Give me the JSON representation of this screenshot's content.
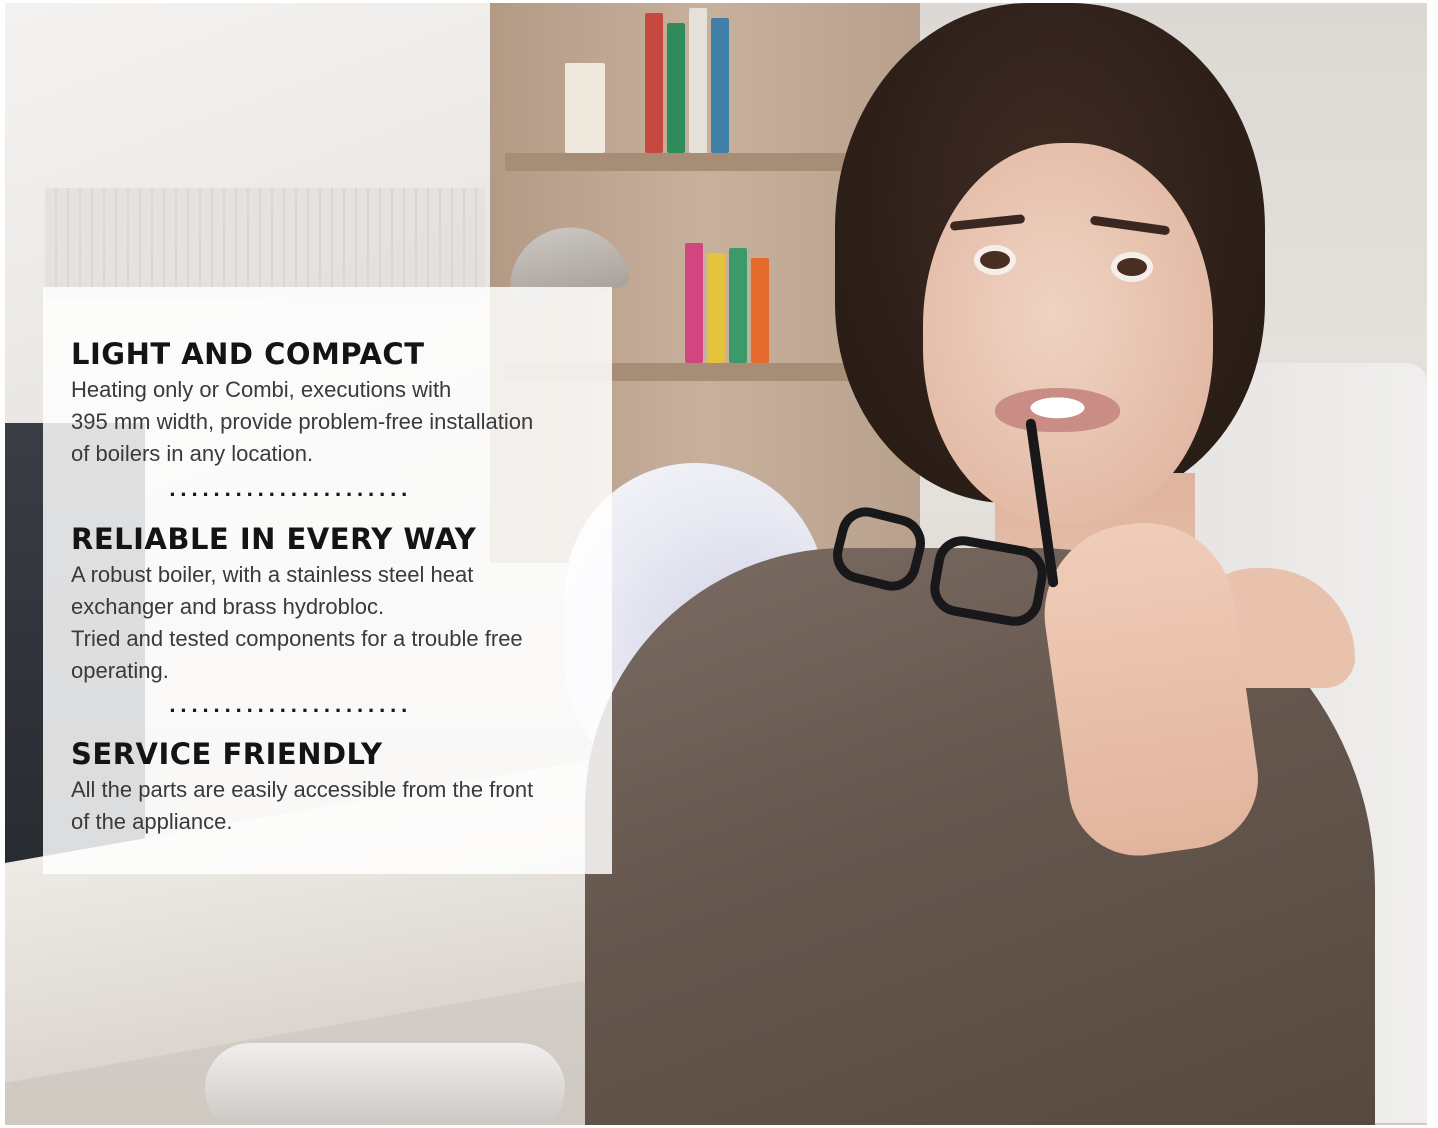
{
  "sections": [
    {
      "title": "LIGHT AND COMPACT",
      "lines": [
        "Heating only or Combi, executions with",
        "395 mm width, provide problem-free installation",
        "of boilers in any location."
      ]
    },
    {
      "title": "RELIABLE IN EVERY WAY",
      "lines": [
        "A robust boiler, with a stainless steel heat",
        "exchanger and brass hydrobloc.",
        "Tried and tested components for a trouble free",
        "operating."
      ]
    },
    {
      "title": "SERVICE FRIENDLY",
      "lines": [
        "All the parts are easily accessible from the front",
        "of the appliance."
      ]
    }
  ],
  "dividers": [
    "......................",
    "......................"
  ]
}
